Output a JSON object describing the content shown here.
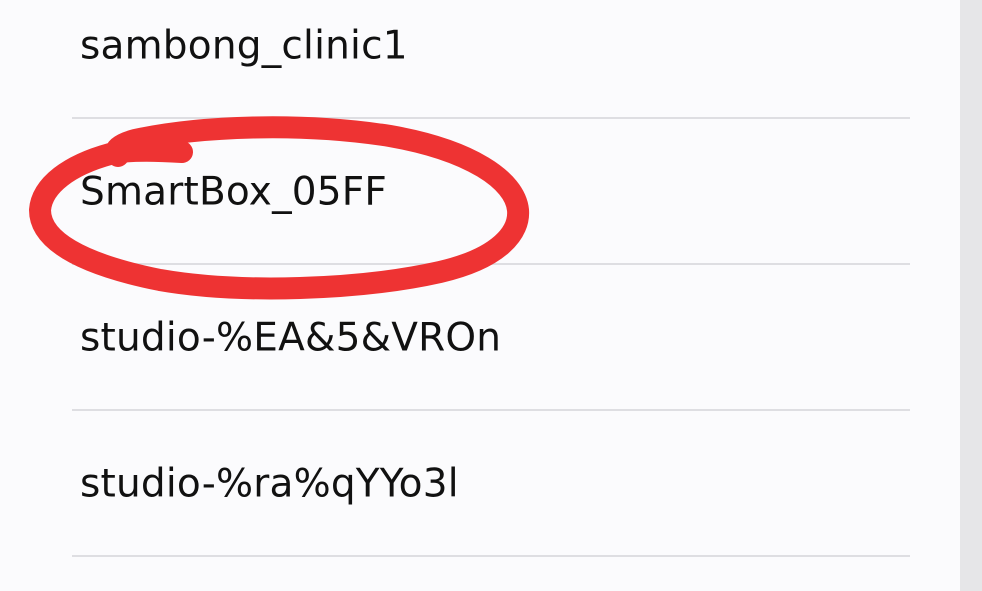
{
  "networks": {
    "items": [
      {
        "label": "sambong_clinic1"
      },
      {
        "label": "SmartBox_05FF"
      },
      {
        "label": "studio-%EA&5&VROn"
      },
      {
        "label": "studio-%ra%qYYo3l"
      }
    ]
  },
  "annotation": {
    "color": "#ee3333"
  }
}
